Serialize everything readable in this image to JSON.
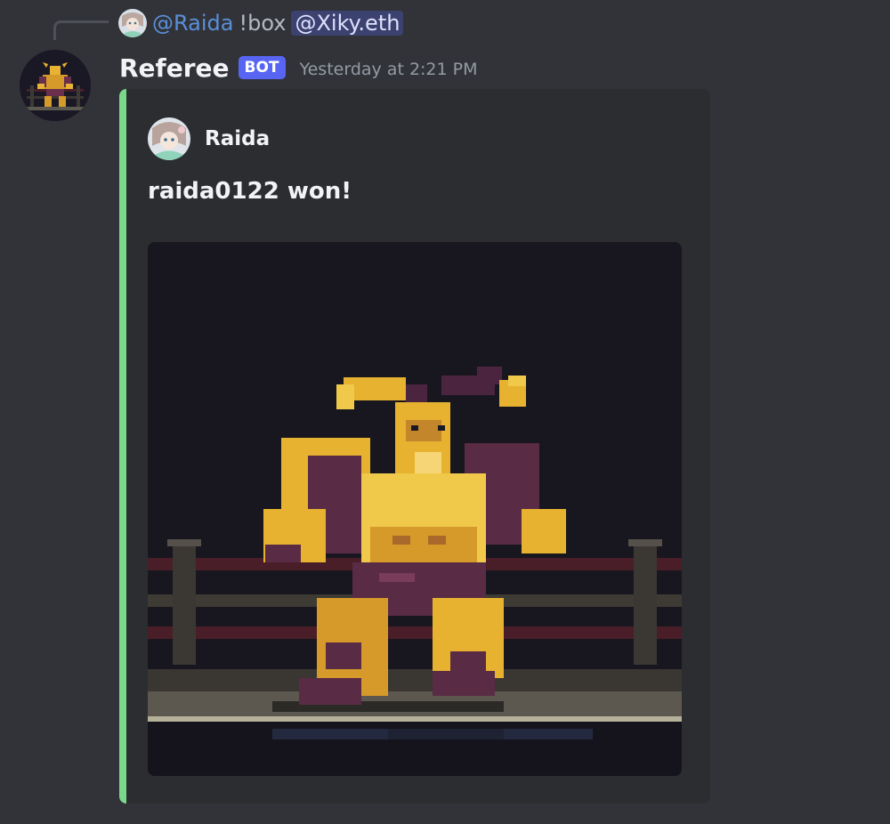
{
  "reply": {
    "author": "@Raida",
    "text": "!box",
    "mention": "@Xiky.eth"
  },
  "message": {
    "author": "Referee",
    "badge": "BOT",
    "timestamp": "Yesterday at 2:21 PM"
  },
  "embed": {
    "accent_color": "#7bd88a",
    "author_name": "Raida",
    "description": "raida0122 won!",
    "image": "pixel-art-minotaur-boxer-in-ring"
  },
  "colors": {
    "background": "#313338",
    "embed_background": "#2b2d31",
    "bot_badge": "#5865f2",
    "reply_author": "#5a8fd8",
    "mention_bg": "#3c4270"
  }
}
